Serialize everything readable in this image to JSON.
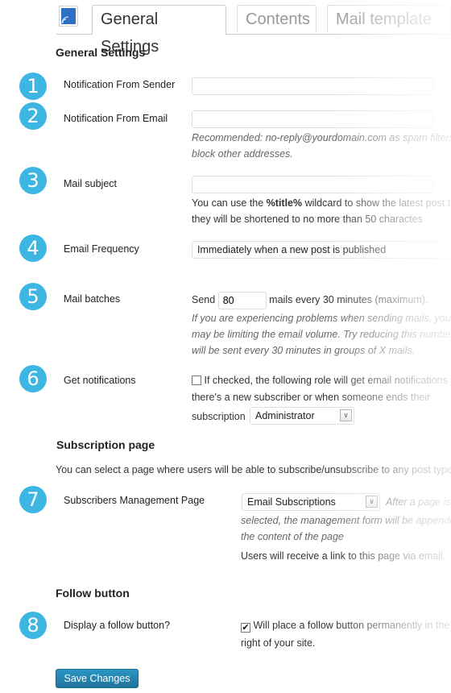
{
  "tabs": [
    {
      "label": "General Settings",
      "active": true
    },
    {
      "label": "Contents",
      "active": false
    },
    {
      "label": "Mail template",
      "active": false
    }
  ],
  "app_icon": "mail-stamp-icon",
  "sections": {
    "general": "General Settings",
    "subscription": "Subscription page",
    "follow": "Follow button"
  },
  "fields": [
    {
      "num": "1",
      "label": "Notification From Sender",
      "value": ""
    },
    {
      "num": "2",
      "label": "Notification From Email",
      "value": "",
      "help": [
        "Recommended: no-reply@yourdomain.com as spam filters",
        "block other addresses."
      ]
    },
    {
      "num": "3",
      "label": "Mail subject",
      "value": "",
      "help_pre": "You can use the ",
      "help_bold": "%title%",
      "help_post": " wildcard to show the latest post title",
      "help2": "they will be shortened to no more than 50 charactes"
    },
    {
      "num": "4",
      "label": "Email Frequency",
      "selected": "Immediately when a new post is published"
    },
    {
      "num": "5",
      "label": "Mail batches",
      "send_label": "Send",
      "value": "80",
      "suffix": "mails every 30 minutes (maximum).",
      "help": [
        "If you are experiencing problems when sending mails, your",
        "may be limiting the email volume. Try reducing this number",
        "will be sent every 30 minutes in groups of X mails."
      ]
    },
    {
      "num": "6",
      "label": "Get notifications",
      "checked": false,
      "text1": "If checked, the following role will get email notifications w",
      "text2": "there's a new subscriber or when someone ends their",
      "text3": "subscription",
      "role": "Administrator"
    }
  ],
  "subscription": {
    "intro": "You can select a page where users will be able to subscribe/unsubscribe to any post type",
    "num": "7",
    "label": "Subscribers Management Page",
    "selected": "Email Subscriptions",
    "help_inline": "After a page is",
    "help": [
      "selected, the management form will be appende",
      "the content of the page"
    ],
    "note": "Users will receive a link to this page via email."
  },
  "follow": {
    "num": "8",
    "label": "Display a follow button?",
    "checked": true,
    "text1": "Will place a follow button permanently in the b",
    "text2": "right of your site."
  },
  "save_label": "Save Changes",
  "colors": {
    "badge": "#3db6e4",
    "button": "#21759b"
  }
}
